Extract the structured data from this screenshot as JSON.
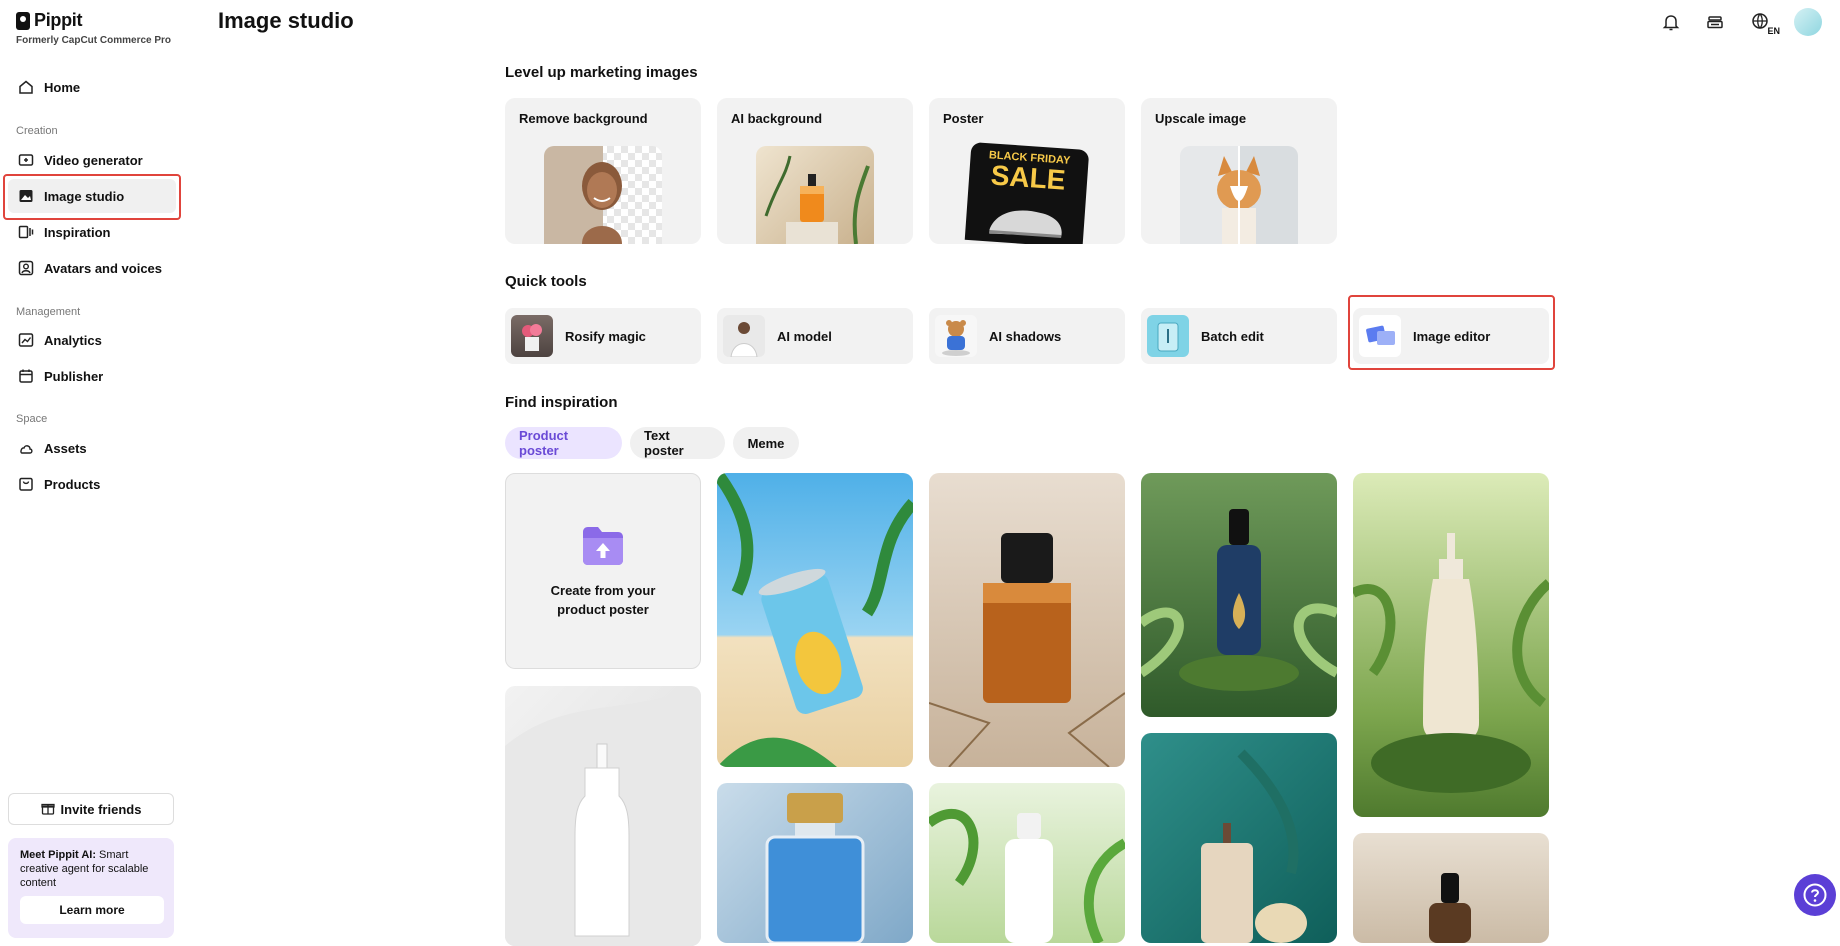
{
  "app": {
    "name": "Pippit",
    "subtitle": "Formerly CapCut Commerce Pro"
  },
  "header": {
    "title": "Image studio",
    "language": "EN"
  },
  "sidebar": {
    "home": "Home",
    "sections": {
      "creation": "Creation",
      "management": "Management",
      "space": "Space"
    },
    "items": {
      "video_generator": "Video generator",
      "image_studio": "Image studio",
      "inspiration": "Inspiration",
      "avatars_voices": "Avatars and voices",
      "analytics": "Analytics",
      "publisher": "Publisher",
      "assets": "Assets",
      "products": "Products"
    },
    "invite": "Invite friends",
    "promo": {
      "title": "Meet Pippit AI:",
      "body": " Smart creative agent for scalable content",
      "button": "Learn more"
    }
  },
  "level_up": {
    "title": "Level up marketing images",
    "cards": [
      "Remove background",
      "AI background",
      "Poster",
      "Upscale image"
    ],
    "poster_text": [
      "BLACK FRIDAY",
      "SALE"
    ]
  },
  "quick_tools": {
    "title": "Quick tools",
    "tools": [
      "Rosify magic",
      "AI model",
      "AI shadows",
      "Batch edit",
      "Image editor"
    ]
  },
  "inspiration": {
    "title": "Find inspiration",
    "chips": [
      "Product poster",
      "Text poster",
      "Meme"
    ],
    "create_card": "Create from your product poster"
  },
  "colors": {
    "accent": "#6a4ad6",
    "highlight": "#e0443c",
    "card_bg": "#f2f2f2"
  }
}
